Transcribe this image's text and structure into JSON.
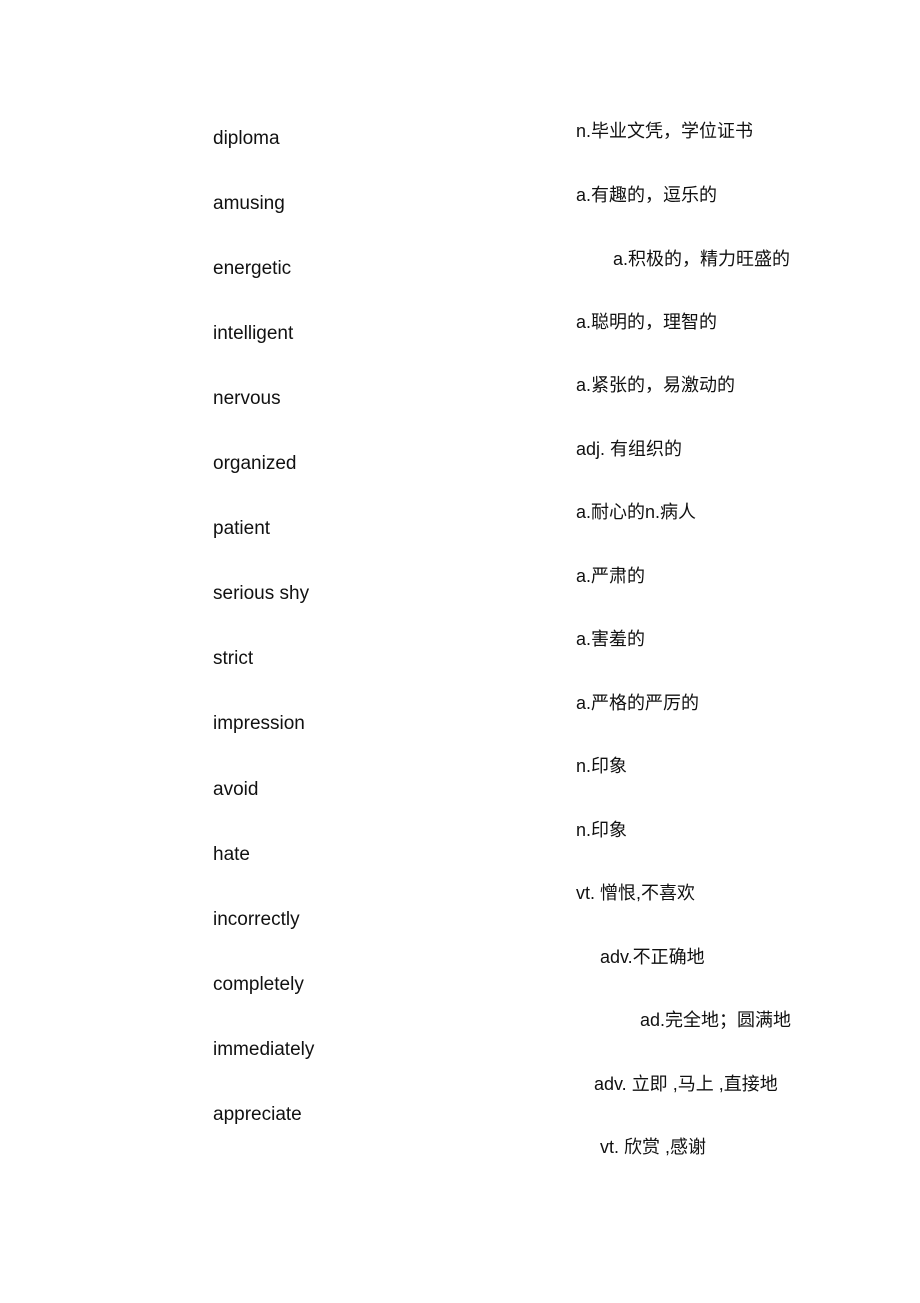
{
  "words": [
    "diploma",
    "amusing",
    "energetic",
    "intelligent",
    "nervous",
    "organized",
    "patient",
    "serious shy",
    "strict",
    "impression",
    "avoid",
    "hate",
    "incorrectly",
    "completely",
    "immediately",
    "appreciate"
  ],
  "definitions": [
    "n.毕业文凭，学位证书",
    "a.有趣的，逗乐的",
    "a.积极的，精力旺盛的",
    "a.聪明的，理智的",
    "a.紧张的，易激动的",
    "adj. 有组织的",
    "a.耐心的n.病人",
    "a.严肃的",
    "a.害羞的",
    "a.严格的严厉的",
    "n.印象",
    "n.印象",
    "vt. 憎恨,不喜欢",
    "adv.不正确地",
    "ad.完全地；圆满地",
    "adv. 立即 ,马上 ,直接地",
    "vt. 欣赏 ,感谢"
  ]
}
